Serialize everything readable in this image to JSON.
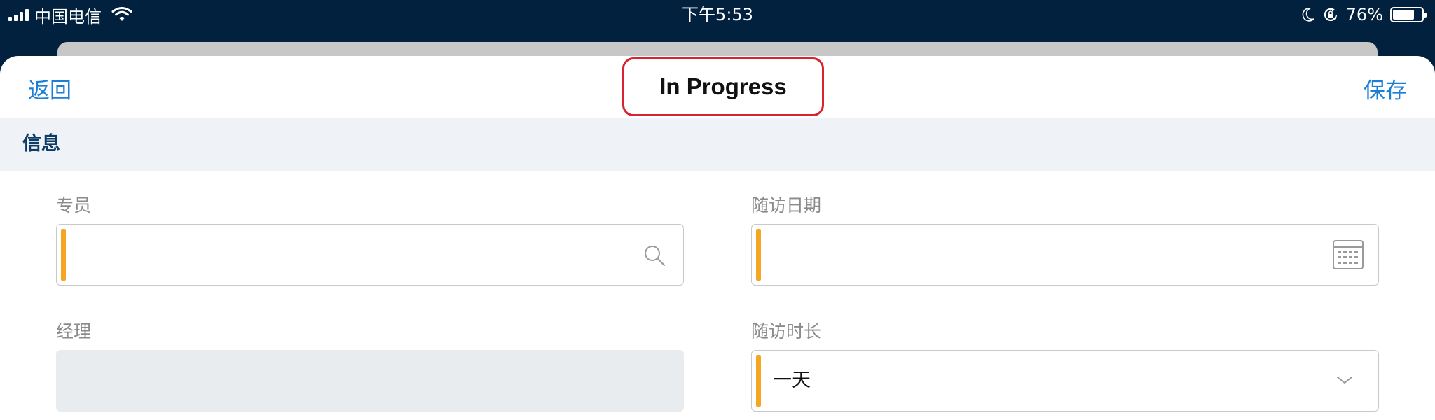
{
  "status_bar": {
    "carrier": "中国电信",
    "time": "下午5:53",
    "battery": "76%",
    "battery_level": 0.76,
    "icons": [
      "signal-icon",
      "wifi-icon",
      "moon-icon",
      "rotation-lock-icon",
      "battery-icon"
    ]
  },
  "navbar": {
    "back_label": "返回",
    "title": "In Progress",
    "save_label": "保存"
  },
  "section": {
    "title": "信息"
  },
  "fields": {
    "specialist": {
      "label": "专员",
      "value": "",
      "required": true,
      "icon": "search-icon"
    },
    "visit_date": {
      "label": "随访日期",
      "value": "",
      "required": true,
      "icon": "calendar-icon"
    },
    "manager": {
      "label": "经理",
      "value": "",
      "disabled": true
    },
    "visit_duration": {
      "label": "随访时长",
      "value": "一天",
      "required": true,
      "icon": "chevron-down-icon"
    }
  },
  "colors": {
    "accent": "#1b7fd6",
    "required_marker": "#f5a623",
    "highlight_border": "#d9232e",
    "status_bar_bg": "#02213e",
    "section_bg": "#eff3f7"
  }
}
